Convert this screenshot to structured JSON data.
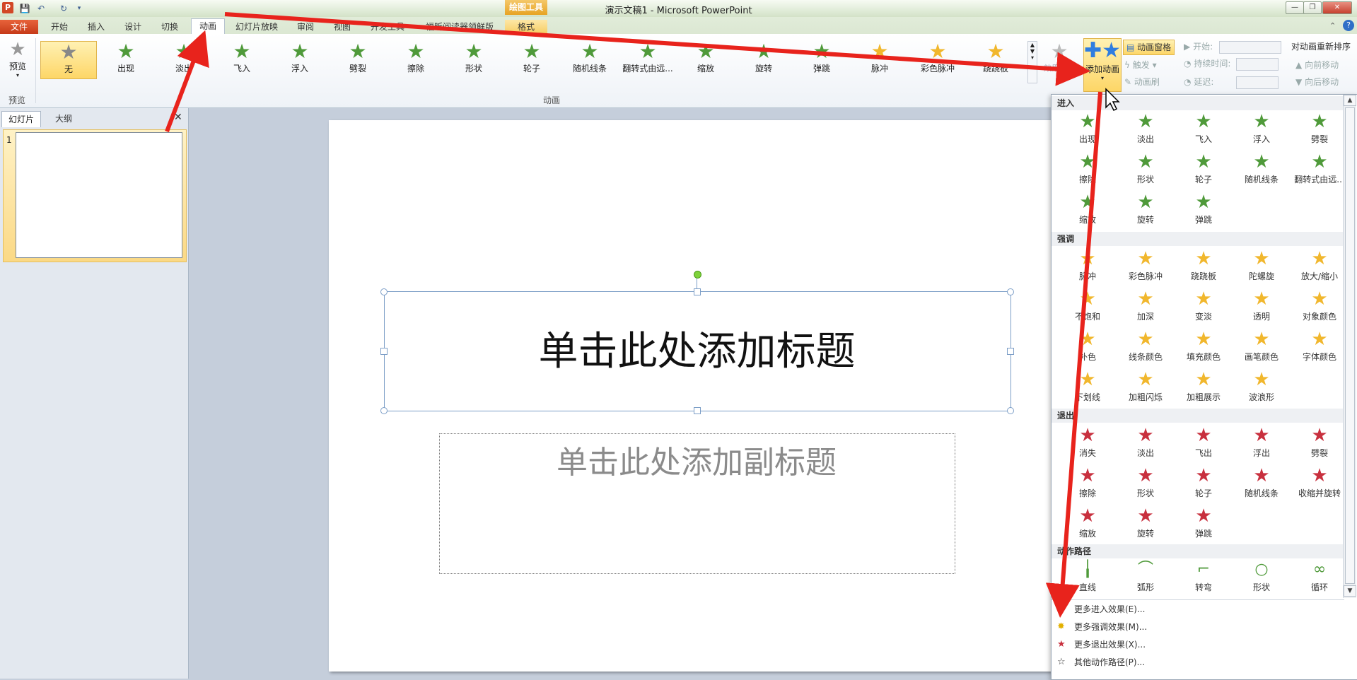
{
  "window": {
    "title": "演示文稿1 - Microsoft PowerPoint",
    "app_icon_letter": "P",
    "context_tools_label": "绘图工具",
    "buttons": {
      "minimize": "—",
      "restore": "❐",
      "close": "✕"
    }
  },
  "tabs": [
    {
      "label": "文件"
    },
    {
      "label": "开始"
    },
    {
      "label": "插入"
    },
    {
      "label": "设计"
    },
    {
      "label": "切换"
    },
    {
      "label": "动画"
    },
    {
      "label": "幻灯片放映"
    },
    {
      "label": "审阅"
    },
    {
      "label": "视图"
    },
    {
      "label": "开发工具"
    },
    {
      "label": "福昕阅读器领鲜版"
    },
    {
      "label": "格式"
    }
  ],
  "ribbon": {
    "preview_label": "预览",
    "preview_group": "预览",
    "animation_group": "动画",
    "effects": [
      "无",
      "出现",
      "淡出",
      "飞入",
      "浮入",
      "劈裂",
      "擦除",
      "形状",
      "轮子",
      "随机线条",
      "翻转式由远...",
      "缩放",
      "旋转",
      "弹跳",
      "脉冲",
      "彩色脉冲",
      "跷跷板"
    ],
    "effect_options_label": "效果选项",
    "add_animation_label": "添加动画",
    "animation_pane_label": "动画窗格",
    "trigger_label": "触发",
    "animation_painter_label": "动画刷",
    "start_label": "开始:",
    "duration_label": "持续时间:",
    "delay_label": "延迟:",
    "reorder_title": "对动画重新排序",
    "move_earlier": "向前移动",
    "move_later": "向后移动"
  },
  "left_panel": {
    "tab_slides": "幻灯片",
    "tab_outline": "大纲",
    "close": "✕",
    "slide_number": "1"
  },
  "slide": {
    "title_placeholder": "单击此处添加标题",
    "subtitle_placeholder": "单击此处添加副标题"
  },
  "dropdown": {
    "enter_header": "进入",
    "enter_items": [
      "出现",
      "淡出",
      "飞入",
      "浮入",
      "劈裂",
      "擦除",
      "形状",
      "轮子",
      "随机线条",
      "翻转式由远...",
      "缩放",
      "旋转",
      "弹跳"
    ],
    "emphasis_header": "强调",
    "emphasis_items": [
      "脉冲",
      "彩色脉冲",
      "跷跷板",
      "陀螺旋",
      "放大/缩小",
      "不饱和",
      "加深",
      "变淡",
      "透明",
      "对象颜色",
      "补色",
      "线条颜色",
      "填充颜色",
      "画笔颜色",
      "字体颜色",
      "下划线",
      "加粗闪烁",
      "加粗展示",
      "波浪形"
    ],
    "exit_header": "退出",
    "exit_items": [
      "消失",
      "淡出",
      "飞出",
      "浮出",
      "劈裂",
      "擦除",
      "形状",
      "轮子",
      "随机线条",
      "收缩并旋转",
      "缩放",
      "旋转",
      "弹跳"
    ],
    "path_header": "动作路径",
    "path_items": [
      "直线",
      "弧形",
      "转弯",
      "形状",
      "循环"
    ],
    "links": [
      "更多进入效果(E)...",
      "更多强调效果(M)...",
      "更多退出效果(X)...",
      "其他动作路径(P)..."
    ]
  },
  "colors": {
    "accent_arrow": "#e8231c",
    "file_tab": "#d24726",
    "highlight": "#fdd667"
  }
}
